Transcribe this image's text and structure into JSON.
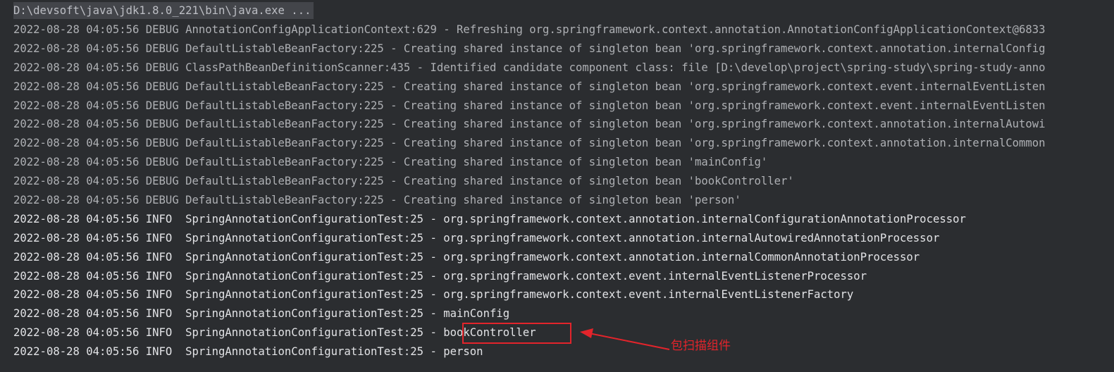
{
  "console": {
    "command": "D:\\devsoft\\java\\jdk1.8.0_221\\bin\\java.exe ...",
    "lines": [
      {
        "level": "debug",
        "text": "2022-08-28 04:05:56 DEBUG AnnotationConfigApplicationContext:629 - Refreshing org.springframework.context.annotation.AnnotationConfigApplicationContext@6833"
      },
      {
        "level": "debug",
        "text": "2022-08-28 04:05:56 DEBUG DefaultListableBeanFactory:225 - Creating shared instance of singleton bean 'org.springframework.context.annotation.internalConfig"
      },
      {
        "level": "debug",
        "text": "2022-08-28 04:05:56 DEBUG ClassPathBeanDefinitionScanner:435 - Identified candidate component class: file [D:\\develop\\project\\spring-study\\spring-study-anno"
      },
      {
        "level": "debug",
        "text": "2022-08-28 04:05:56 DEBUG DefaultListableBeanFactory:225 - Creating shared instance of singleton bean 'org.springframework.context.event.internalEventListen"
      },
      {
        "level": "debug",
        "text": "2022-08-28 04:05:56 DEBUG DefaultListableBeanFactory:225 - Creating shared instance of singleton bean 'org.springframework.context.event.internalEventListen"
      },
      {
        "level": "debug",
        "text": "2022-08-28 04:05:56 DEBUG DefaultListableBeanFactory:225 - Creating shared instance of singleton bean 'org.springframework.context.annotation.internalAutowi"
      },
      {
        "level": "debug",
        "text": "2022-08-28 04:05:56 DEBUG DefaultListableBeanFactory:225 - Creating shared instance of singleton bean 'org.springframework.context.annotation.internalCommon"
      },
      {
        "level": "debug",
        "text": "2022-08-28 04:05:56 DEBUG DefaultListableBeanFactory:225 - Creating shared instance of singleton bean 'mainConfig'"
      },
      {
        "level": "debug",
        "text": "2022-08-28 04:05:56 DEBUG DefaultListableBeanFactory:225 - Creating shared instance of singleton bean 'bookController'"
      },
      {
        "level": "debug",
        "text": "2022-08-28 04:05:56 DEBUG DefaultListableBeanFactory:225 - Creating shared instance of singleton bean 'person'"
      },
      {
        "level": "info",
        "text": "2022-08-28 04:05:56 INFO  SpringAnnotationConfigurationTest:25 - org.springframework.context.annotation.internalConfigurationAnnotationProcessor"
      },
      {
        "level": "info",
        "text": "2022-08-28 04:05:56 INFO  SpringAnnotationConfigurationTest:25 - org.springframework.context.annotation.internalAutowiredAnnotationProcessor"
      },
      {
        "level": "info",
        "text": "2022-08-28 04:05:56 INFO  SpringAnnotationConfigurationTest:25 - org.springframework.context.annotation.internalCommonAnnotationProcessor"
      },
      {
        "level": "info",
        "text": "2022-08-28 04:05:56 INFO  SpringAnnotationConfigurationTest:25 - org.springframework.context.event.internalEventListenerProcessor"
      },
      {
        "level": "info",
        "text": "2022-08-28 04:05:56 INFO  SpringAnnotationConfigurationTest:25 - org.springframework.context.event.internalEventListenerFactory"
      },
      {
        "level": "info",
        "text": "2022-08-28 04:05:56 INFO  SpringAnnotationConfigurationTest:25 - mainConfig"
      },
      {
        "level": "info",
        "text": "2022-08-28 04:05:56 INFO  SpringAnnotationConfigurationTest:25 - bookController"
      },
      {
        "level": "info",
        "text": "2022-08-28 04:05:56 INFO  SpringAnnotationConfigurationTest:25 - person"
      }
    ]
  },
  "annotation": {
    "label": "包扫描组件",
    "color": "#e3242b"
  },
  "colors": {
    "background": "#2b2d30",
    "debug_text": "#aeb0b4",
    "info_text": "#e2e3e6"
  }
}
